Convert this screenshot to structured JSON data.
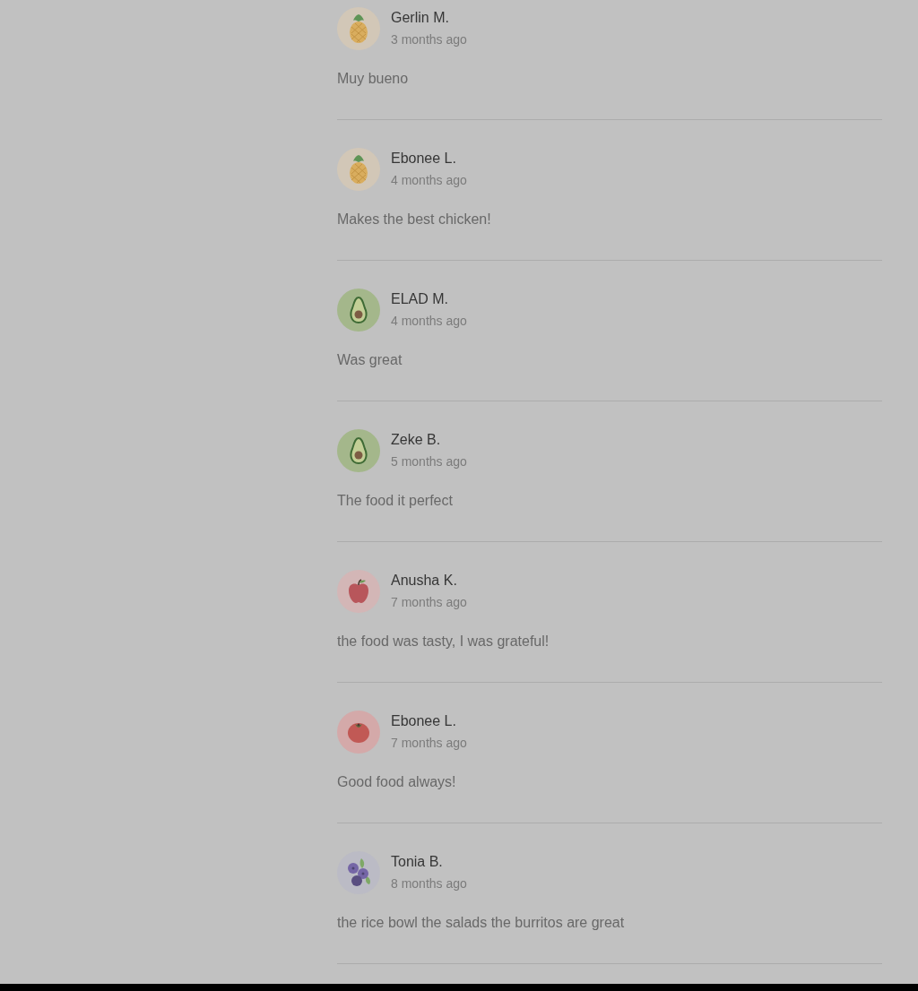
{
  "reviews": [
    {
      "kind": "pineapple",
      "name": "Gerlin M.",
      "time": "3 months ago",
      "comment": "Muy bueno"
    },
    {
      "kind": "pineapple",
      "name": "Ebonee L.",
      "time": "4 months ago",
      "comment": "Makes the best chicken!"
    },
    {
      "kind": "avocado",
      "name": "ELAD M.",
      "time": "4 months ago",
      "comment": "Was great"
    },
    {
      "kind": "avocado",
      "name": "Zeke B.",
      "time": "5 months ago",
      "comment": "The food it perfect"
    },
    {
      "kind": "apple",
      "name": "Anusha K.",
      "time": "7 months ago",
      "comment": "the food was tasty, I was grateful!"
    },
    {
      "kind": "tomato",
      "name": "Ebonee L.",
      "time": "7 months ago",
      "comment": "Good food always!"
    },
    {
      "kind": "blueberries",
      "name": "Tonia B.",
      "time": "8 months ago",
      "comment": "the rice bowl the salads the burritos are great"
    }
  ]
}
